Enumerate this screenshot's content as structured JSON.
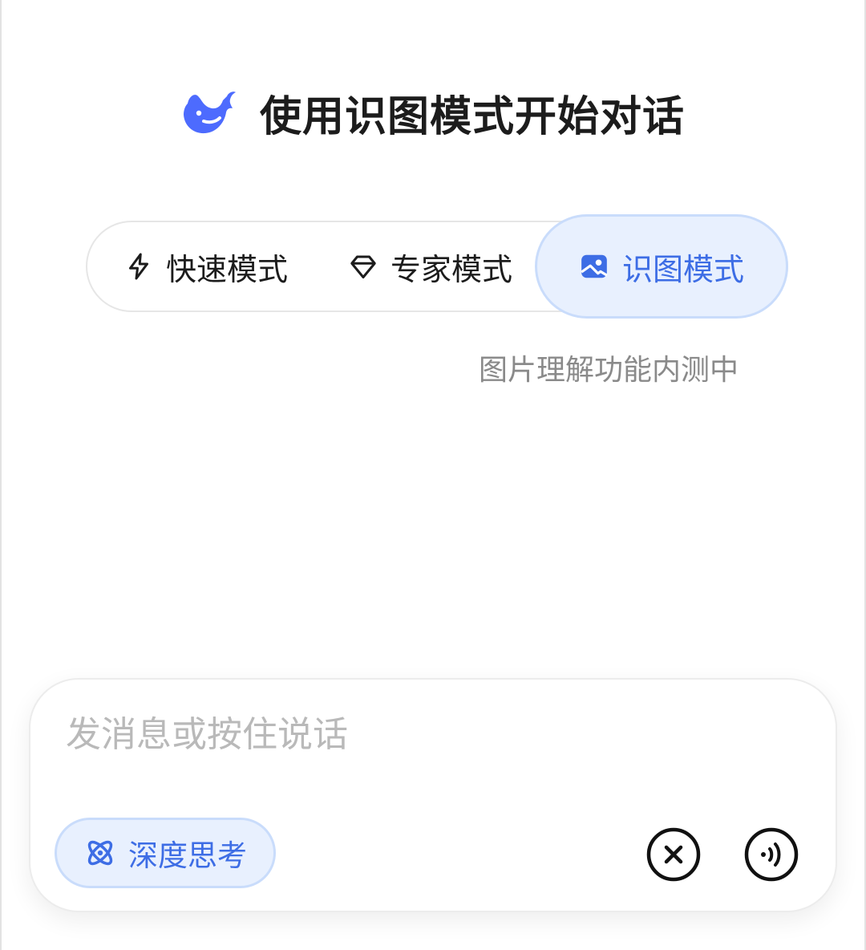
{
  "header": {
    "logo_icon": "deepseek-whale-icon",
    "title": "使用识图模式开始对话"
  },
  "modes": {
    "items": [
      {
        "label": "快速模式",
        "icon": "lightning-icon",
        "selected": false
      },
      {
        "label": "专家模式",
        "icon": "diamond-icon",
        "selected": false
      },
      {
        "label": "识图模式",
        "icon": "image-icon",
        "selected": true
      }
    ],
    "note": "图片理解功能内测中"
  },
  "composer": {
    "placeholder": "发消息或按住说话",
    "value": "",
    "deep_think_label": "深度思考",
    "deep_think_icon": "atom-icon",
    "clear_icon": "close-circle-icon",
    "voice_icon": "voice-wave-icon"
  },
  "colors": {
    "accent": "#3d6de5",
    "accent_bg": "#e8f0fe",
    "accent_border": "#c9dcfb",
    "text": "#1c1c1c",
    "muted": "#8a8a8a",
    "placeholder": "#b9b9b9"
  }
}
